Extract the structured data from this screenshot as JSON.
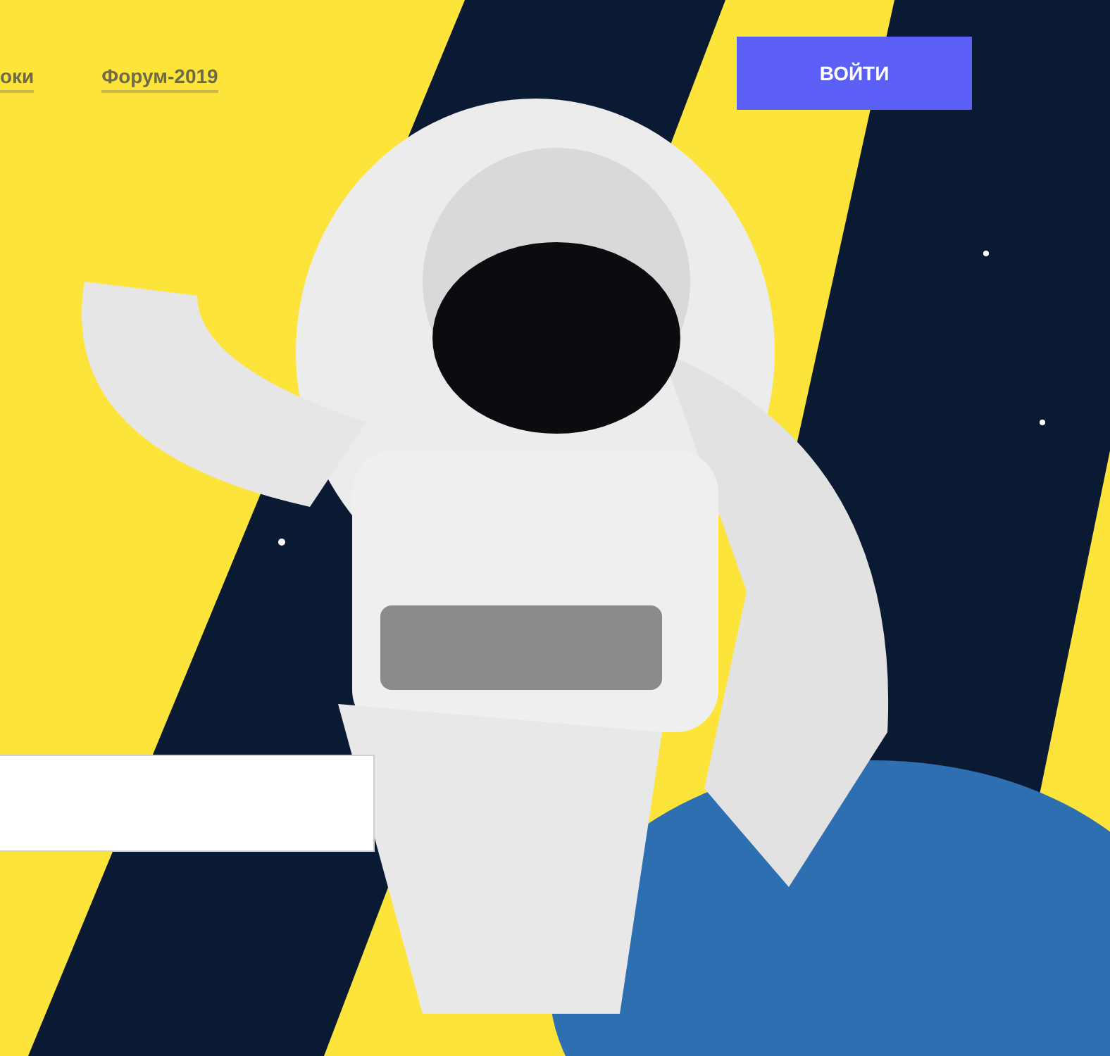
{
  "nav": {
    "links": [
      {
        "label": "оки"
      },
      {
        "label": "Форум-2019"
      }
    ]
  },
  "login_button": {
    "label": "ВОЙТИ"
  },
  "search": {
    "kind": "field"
  }
}
